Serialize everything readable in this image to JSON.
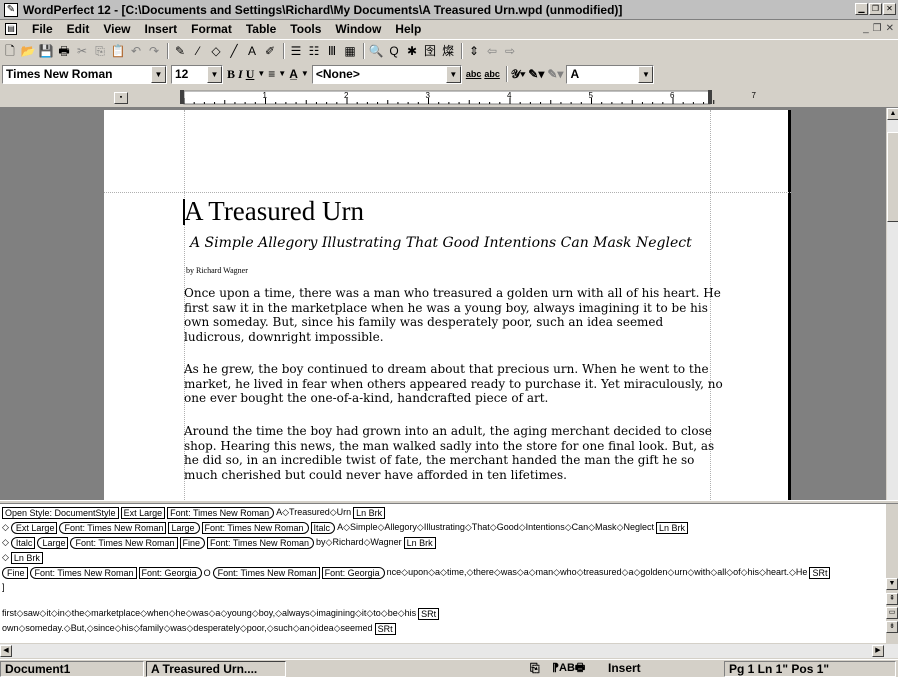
{
  "window": {
    "title": "WordPerfect 12 - [C:\\Documents and Settings\\Richard\\My Documents\\A Treasured Urn.wpd (unmodified)]",
    "controls": [
      "minimize",
      "restore",
      "close"
    ]
  },
  "menu": {
    "items": [
      "File",
      "Edit",
      "View",
      "Insert",
      "Format",
      "Table",
      "Tools",
      "Window",
      "Help"
    ]
  },
  "toolbar": {
    "icons": [
      "new-icon",
      "open-icon",
      "save-icon",
      "print-icon",
      "cut-icon",
      "copy-icon",
      "paste-icon",
      "undo-icon",
      "redo-icon",
      "highlight-icon",
      "draw-line-icon",
      "shape-icon",
      "line-icon",
      "textbox-icon",
      "brush-icon",
      "bullets-icon",
      "numbering-icon",
      "columns-icon",
      "table-icon",
      "zoom-icon",
      "find-icon",
      "symbols-icon",
      "chinese-icon",
      "convert-icon",
      "updown-icon",
      "back-icon",
      "forward-icon"
    ],
    "glyphs": [
      "🗋",
      "📂",
      "💾",
      "🖶",
      "✂",
      "⎘",
      "📋",
      "↶",
      "↷",
      "✎",
      "⁄",
      "◇",
      "╱",
      "A",
      "✐",
      "☰",
      "☷",
      "Ⅲ",
      "▦",
      "🔍",
      "Q",
      "✱",
      "囹",
      "燦",
      "⇕",
      "⇦",
      "⇨"
    ]
  },
  "property_bar": {
    "font": "Times New Roman",
    "size": "12",
    "bold": "B",
    "italic": "I",
    "underline": "U",
    "justify": "≡",
    "font_attr": "A̲",
    "style": "<None>",
    "abc1": "abc",
    "abc2": "abc",
    "prompt": "A"
  },
  "ruler": {
    "numbers": [
      "1",
      "2",
      "3",
      "4",
      "5",
      "6",
      "7"
    ]
  },
  "document": {
    "title": "A Treasured Urn",
    "subtitle": "A Simple Allegory Illustrating That Good Intentions Can Mask Neglect",
    "byline": "by Richard Wagner",
    "paragraphs": [
      [
        "Once upon a time, there was a man who treasured a golden urn with all of his heart. He",
        "first saw it in the marketplace when he was a young boy, always imagining it to be his",
        "own someday. But, since his family was desperately poor, such an idea seemed",
        "ludicrous, downright impossible."
      ],
      [
        "As he grew, the boy continued to dream about that precious urn. When he went to the",
        "market, he lived in fear when others appeared ready to purchase it. Yet miraculously, no",
        "one ever bought the one-of-a-kind, handcrafted piece of art."
      ],
      [
        "Around the time the boy had grown into an adult, the aging merchant decided to close",
        "shop. Hearing this news, the man walked sadly into the store for one final look. But, as",
        "he did so, in an incredible twist of fate, the merchant handed the man the gift he so",
        "much cherished but could never have afforded in ten lifetimes."
      ]
    ]
  },
  "reveal_codes": {
    "row1": {
      "c1": "Open Style: DocumentStyle",
      "c2": "Ext Large",
      "c3": "Font: Times New Roman",
      "t1": "A◇Treasured◇Urn",
      "c4": "Ln Brk"
    },
    "row2": {
      "c1": "Ext Large",
      "c2": "Font: Times New Roman",
      "c3": "Large",
      "c4": "Font: Times New Roman",
      "c5": "Italc",
      "t1": "A◇Simple◇Allegory◇Illustrating◇That◇Good◇Intentions◇Can◇Mask◇Neglect",
      "c6": "Ln Brk"
    },
    "row3": {
      "c1": "Italc",
      "c2": "Large",
      "c3": "Font: Times New Roman",
      "c4": "Fine",
      "c5": "Font: Times New Roman",
      "t1": "by◇Richard◇Wagner",
      "c6": "Ln Brk"
    },
    "row4": {
      "c1": "Ln Brk"
    },
    "row5": {
      "c1": "Fine",
      "c2": "Font: Times New Roman",
      "c3": "Font: Georgia",
      "t1": "O",
      "c4": "Font: Times New Roman",
      "c5": "Font: Georgia",
      "t2": "nce◇upon◇a◇time,◇there◇was◇a◇man◇who◇treasured◇a◇golden◇urn◇with◇all◇of◇his◇heart.◇He",
      "c6": "SRt"
    },
    "row6": {
      "t1": "]"
    },
    "row7": {
      "t1": "first◇saw◇it◇in◇the◇marketplace◇when◇he◇was◇a◇young◇boy,◇always◇imagining◇it◇to◇be◇his",
      "c1": "SRt"
    },
    "row8": {
      "t1": "own◇someday.◇But,◇since◇his◇family◇was◇desperately◇poor,◇such◇an◇idea◇seemed",
      "c1": "SRt"
    }
  },
  "status": {
    "doc_tab": "Document1",
    "doc_title_tab": "A Treasured Urn....",
    "mode": "Insert",
    "position": "Pg 1 Ln 1\" Pos 1\""
  }
}
